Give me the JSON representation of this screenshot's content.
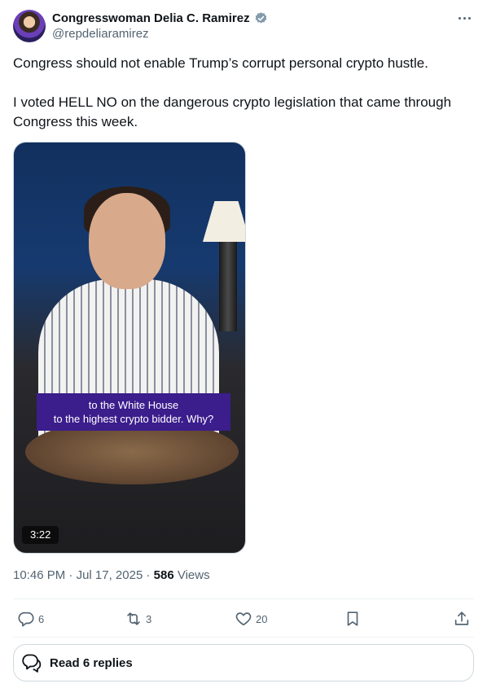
{
  "author": {
    "name": "Congresswoman Delia C. Ramirez",
    "handle": "@repdeliaramirez"
  },
  "tweet": {
    "paragraph1": "Congress should not enable Trump’s corrupt personal crypto hustle.",
    "paragraph2": "I voted HELL NO on the dangerous crypto legislation that came through Congress this week."
  },
  "video": {
    "caption_line1": "to the White House",
    "caption_line2": "to the highest crypto bidder. Why?",
    "duration": "3:22"
  },
  "meta": {
    "time": "10:46 PM",
    "separator": "·",
    "date": "Jul 17, 2025",
    "views_count": "586",
    "views_label": "Views"
  },
  "actions": {
    "replies": "6",
    "reposts": "3",
    "likes": "20"
  },
  "read_replies_label": "Read 6 replies",
  "icons": {
    "verified": "verified-badge-icon",
    "more": "more-icon",
    "reply": "reply-icon",
    "repost": "repost-icon",
    "like": "heart-icon",
    "bookmark": "bookmark-icon",
    "share": "share-icon",
    "read_replies": "speech-bubbles-icon"
  },
  "colors": {
    "text": "#0f1419",
    "secondary": "#536471",
    "verified": "#829aab",
    "border": "#cfd9de",
    "caption_bg": "#3b1d8c"
  }
}
